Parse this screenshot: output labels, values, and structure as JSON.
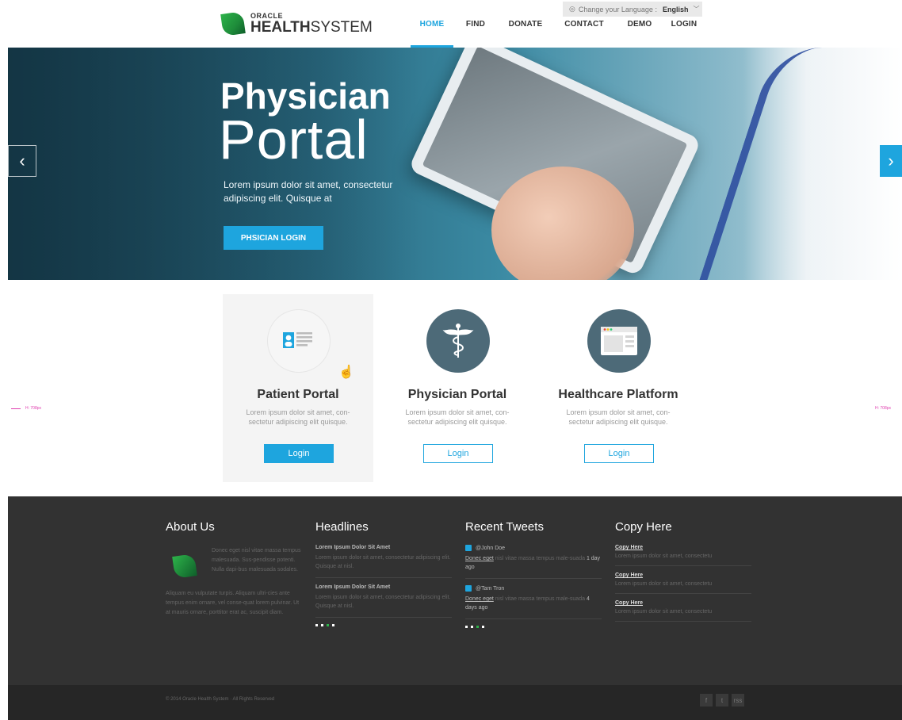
{
  "header": {
    "language_label": "Change your Language :",
    "language_value": "English",
    "logo_top": "ORACLE",
    "logo_bold": "HEALTH",
    "logo_light": "SYSTEM",
    "nav": [
      {
        "label": "HOME",
        "active": true
      },
      {
        "label": "FIND",
        "active": false
      },
      {
        "label": "DONATE",
        "active": false
      },
      {
        "label": "CONTACT",
        "active": false
      },
      {
        "label": "DEMO",
        "active": false
      },
      {
        "label": "LOGIN",
        "active": false
      }
    ]
  },
  "hero": {
    "title_line1": "Physician",
    "title_line2": "Portal",
    "text": "Lorem ipsum dolor sit amet, consectetur adipiscing elit. Quisque at",
    "button": "PHSICIAN LOGIN",
    "prev_glyph": "‹",
    "next_glyph": "›"
  },
  "marks": {
    "left": "H: 708px",
    "right": "H: 708px"
  },
  "cards": [
    {
      "title": "Patient Portal",
      "text": "Lorem ipsum dolor sit amet, con-sectetur adipiscing elit quisque.",
      "button": "Login",
      "icon": "patient-id-card-icon"
    },
    {
      "title": "Physician Portal",
      "text": "Lorem ipsum dolor sit amet, con-sectetur adipiscing elit quisque.",
      "button": "Login",
      "icon": "caduceus-icon"
    },
    {
      "title": "Healthcare Platform",
      "text": "Lorem ipsum dolor sit amet, con-sectetur adipiscing elit quisque.",
      "button": "Login",
      "icon": "browser-window-icon"
    }
  ],
  "footer": {
    "about": {
      "heading": "About Us",
      "text1": "Donec eget nisl vitae massa tempus malesuada. Sus-pendisse potenti. Nulla dapi-bus malesuada sodales.",
      "text2": "Aliquam eu vulputate turpis. Aliquam ultri-cies ante tempus enim ornare, vel conse-quat lorem pulvinar. Ut at mauris ornare, porttitor erat ac, suscipit diam."
    },
    "headlines": {
      "heading": "Headlines",
      "items": [
        {
          "title": "Lorem Ipsum Dolor Sit Amet",
          "body": "Lorem ipsum dolor sit amet, consectetur adipiscing elit. Quisque at nisl."
        },
        {
          "title": "Lorem Ipsum Dolor Sit Amet",
          "body": "Lorem ipsum dolor sit amet, consectetur adipiscing elit. Quisque at nisl."
        }
      ]
    },
    "tweets": {
      "heading": "Recent Tweets",
      "items": [
        {
          "user": "@John Doe",
          "link": "Donec eget",
          "body": "nisl vitae massa tempus male-suada",
          "time": "1 day ago"
        },
        {
          "user": "@Tam Tron",
          "link": "Donec eget",
          "body": "nisl vitae massa tempus male-suada",
          "time": "4 days ago"
        }
      ]
    },
    "copy": {
      "heading": "Copy Here",
      "items": [
        {
          "title": "Copy Here",
          "body": "Lorem ipsum dolor sit amet, consectetu"
        },
        {
          "title": "Copy Here",
          "body": "Lorem ipsum dolor sit amet, consectetu"
        },
        {
          "title": "Copy Here",
          "body": "Lorem ipsum dolor sit amet, consectetu"
        }
      ]
    },
    "copyright": "© 2014 Oracle Health System  ·  All Rights Reserved",
    "social": [
      "f",
      "t",
      "rss"
    ]
  },
  "colors": {
    "accent": "#1ea5de",
    "footer": "#323232",
    "copybar": "#262626"
  }
}
